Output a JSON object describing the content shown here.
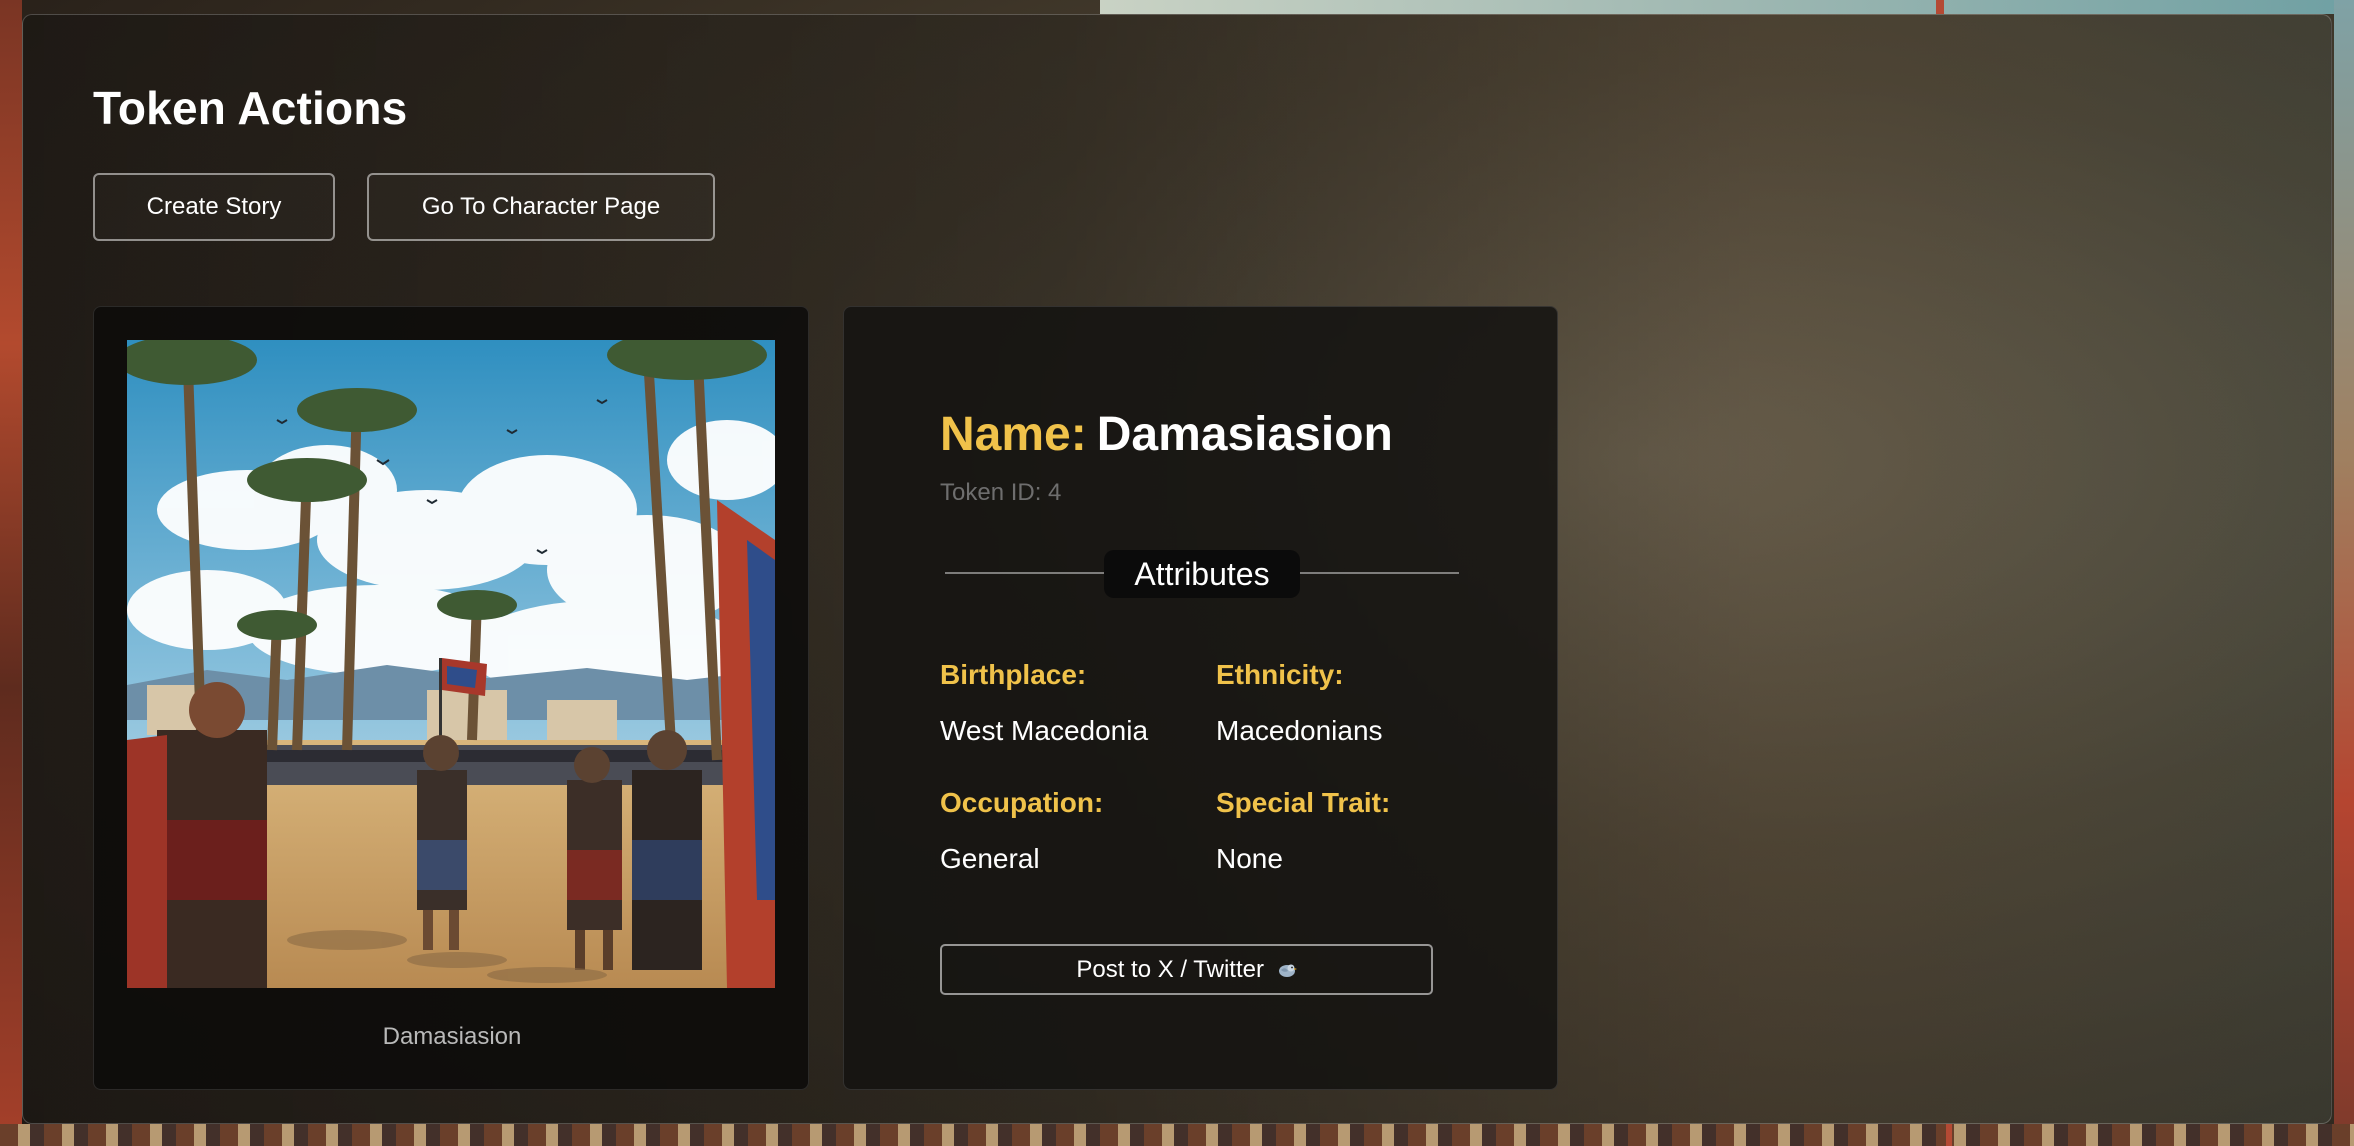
{
  "header": {
    "title": "Token Actions",
    "create_story_label": "Create Story",
    "character_page_label": "Go To Character Page"
  },
  "image_card": {
    "caption": "Damasiasion"
  },
  "info_card": {
    "name_label": "Name:",
    "name_value": "Damasiasion",
    "token_id": "Token ID: 4",
    "attributes_heading": "Attributes",
    "attributes": [
      {
        "key": "Birthplace:",
        "value": "West Macedonia"
      },
      {
        "key": "Ethnicity:",
        "value": "Macedonians"
      },
      {
        "key": "Occupation:",
        "value": "General"
      },
      {
        "key": "Special Trait:",
        "value": "None"
      }
    ],
    "post_label": "Post to X / Twitter",
    "post_icon": "bird-icon"
  },
  "colors": {
    "accent_gold": "#f0c24a",
    "text_primary": "#ffffff",
    "text_muted": "#6e6e6e",
    "card_bg": "#141311"
  }
}
